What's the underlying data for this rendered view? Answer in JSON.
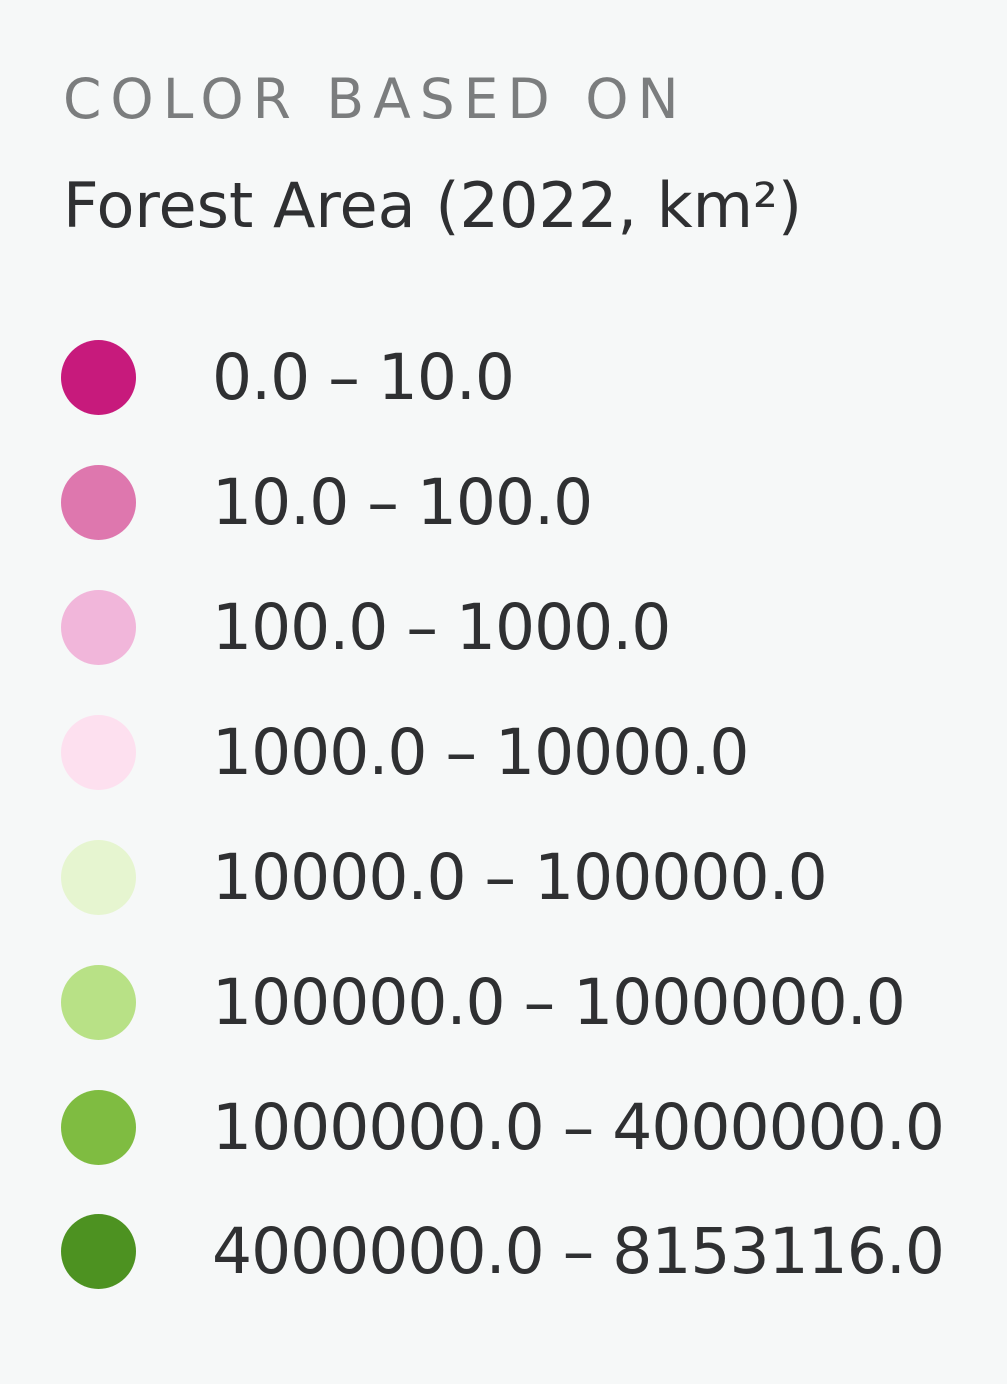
{
  "legend": {
    "eyebrow": "COLOR BASED ON",
    "title": "Forest Area (2022, km²)",
    "items": [
      {
        "label": "0.0 – 10.0",
        "color": "#c71a7c"
      },
      {
        "label": "10.0 – 100.0",
        "color": "#de77ae"
      },
      {
        "label": "100.0 – 1000.0",
        "color": "#f1b6da"
      },
      {
        "label": "1000.0 – 10000.0",
        "color": "#fde0ef"
      },
      {
        "label": "10000.0 – 100000.0",
        "color": "#e6f5d0"
      },
      {
        "label": "100000.0 – 1000000.0",
        "color": "#b8e186"
      },
      {
        "label": "1000000.0 – 4000000.0",
        "color": "#7fbc41"
      },
      {
        "label": "4000000.0 – 8153116.0",
        "color": "#4d9221"
      }
    ]
  }
}
